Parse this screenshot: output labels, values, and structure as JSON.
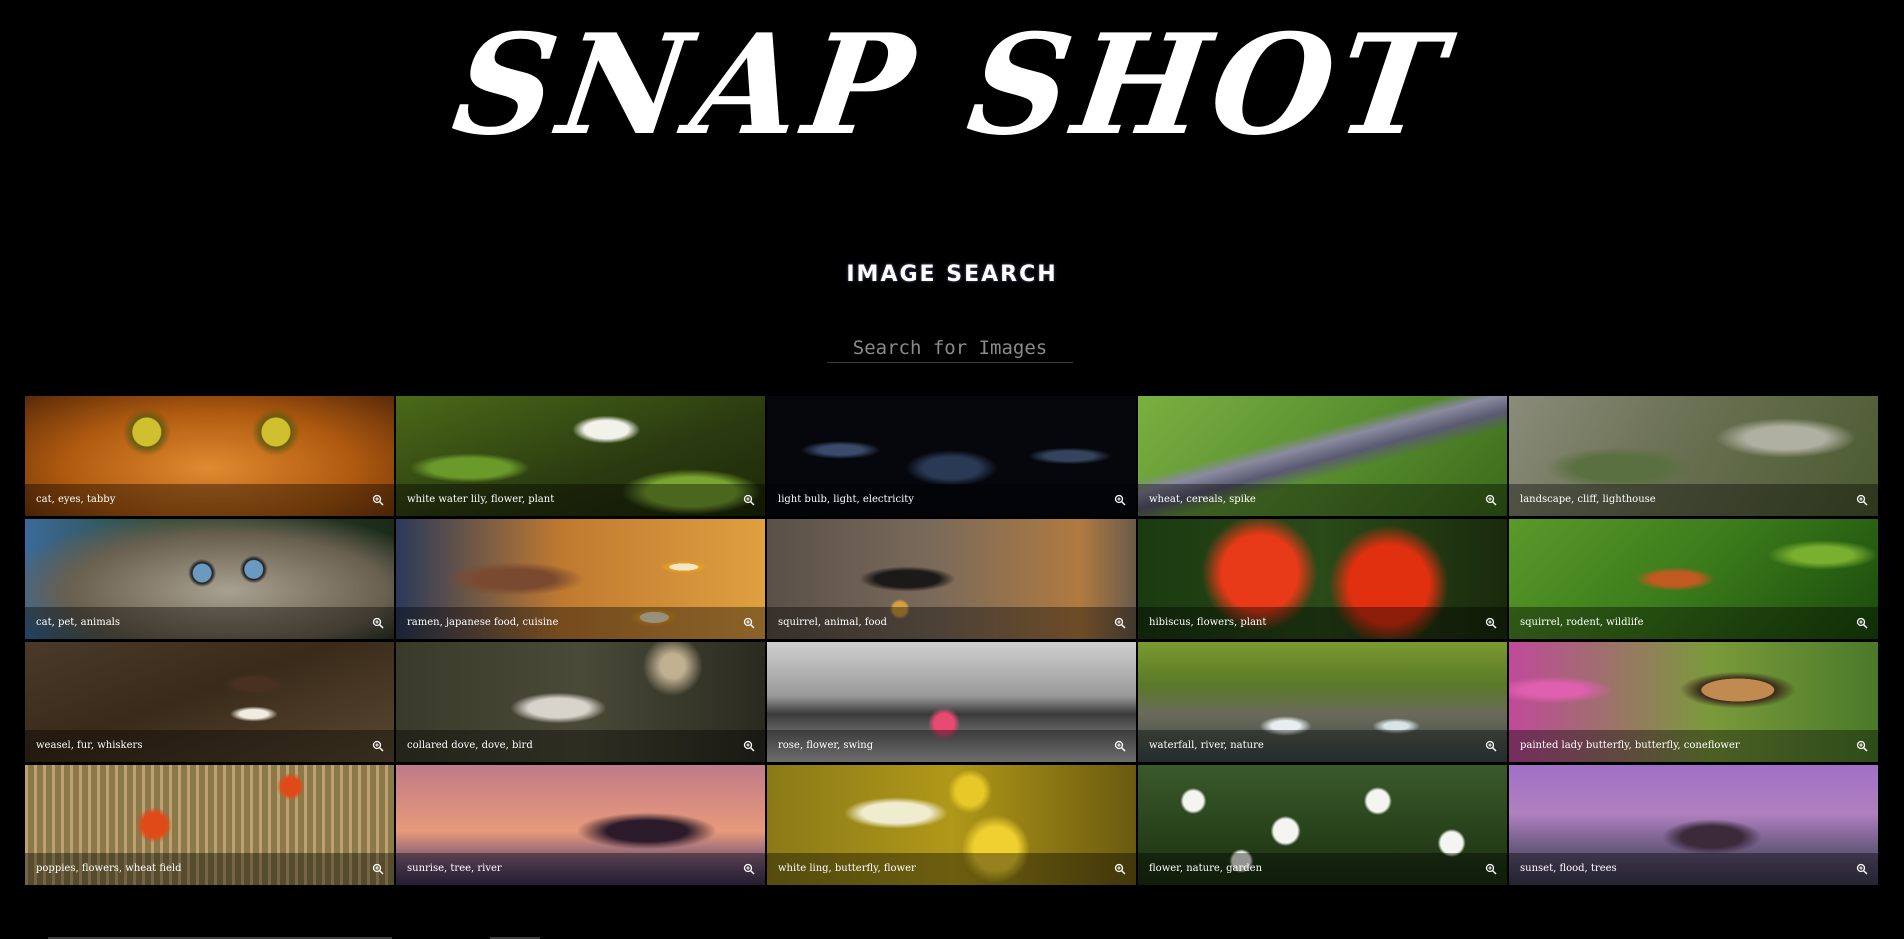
{
  "header": {
    "logo": "SNAP SHOT",
    "subtitle": "IMAGE SEARCH"
  },
  "search": {
    "value": "",
    "placeholder": "Search for Images"
  },
  "results": [
    {
      "caption": "cat, eyes, tabby",
      "icon": "zoom-in-icon"
    },
    {
      "caption": "white water lily, flower, plant",
      "icon": "zoom-in-icon"
    },
    {
      "caption": "light bulb, light, electricity",
      "icon": "zoom-in-icon"
    },
    {
      "caption": "wheat, cereals, spike",
      "icon": "zoom-in-icon"
    },
    {
      "caption": "landscape, cliff, lighthouse",
      "icon": "zoom-in-icon"
    },
    {
      "caption": "cat, pet, animals",
      "icon": "zoom-in-icon"
    },
    {
      "caption": "ramen, japanese food, cuisine",
      "icon": "zoom-in-icon"
    },
    {
      "caption": "squirrel, animal, food",
      "icon": "zoom-in-icon"
    },
    {
      "caption": "hibiscus, flowers, plant",
      "icon": "zoom-in-icon"
    },
    {
      "caption": "squirrel, rodent, wildlife",
      "icon": "zoom-in-icon"
    },
    {
      "caption": "weasel, fur, whiskers",
      "icon": "zoom-in-icon"
    },
    {
      "caption": "collared dove, dove, bird",
      "icon": "zoom-in-icon"
    },
    {
      "caption": "rose, flower, swing",
      "icon": "zoom-in-icon"
    },
    {
      "caption": "waterfall, river, nature",
      "icon": "zoom-in-icon"
    },
    {
      "caption": "painted lady butterfly, butterfly, coneflower",
      "icon": "zoom-in-icon"
    },
    {
      "caption": "poppies, flowers, wheat field",
      "icon": "zoom-in-icon"
    },
    {
      "caption": "sunrise, tree, river",
      "icon": "zoom-in-icon"
    },
    {
      "caption": "white ling, butterfly, flower",
      "icon": "zoom-in-icon"
    },
    {
      "caption": "flower, nature, garden",
      "icon": "zoom-in-icon"
    },
    {
      "caption": "sunset, flood, trees",
      "icon": "zoom-in-icon"
    }
  ]
}
